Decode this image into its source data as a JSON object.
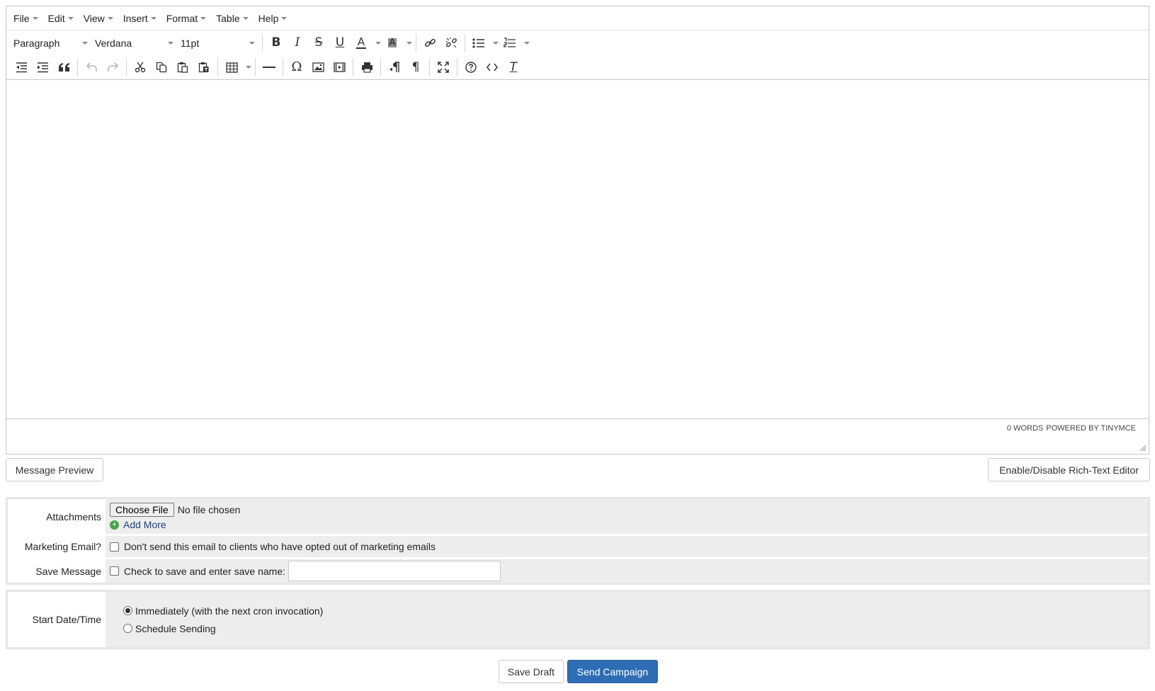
{
  "menubar": {
    "items": [
      "File",
      "Edit",
      "View",
      "Insert",
      "Format",
      "Table",
      "Help"
    ]
  },
  "toolbar": {
    "block_format": "Paragraph",
    "font_family": "Verdana",
    "font_size": "11pt",
    "icons": {
      "bold": "B",
      "italic": "I",
      "strikethrough": "S",
      "underline": "U",
      "text_color": "A",
      "highlight": "A",
      "special_char": "Ω",
      "pilcrow": "¶",
      "clear_format": "T"
    }
  },
  "statusbar": {
    "words": "0 WORDS",
    "powered": "POWERED BY TINYMCE"
  },
  "actions": {
    "message_preview": "Message Preview",
    "toggle_editor": "Enable/Disable Rich-Text Editor"
  },
  "options": {
    "attachments_label": "Attachments",
    "choose_file": "Choose File",
    "no_file": "No file chosen",
    "add_more": "Add More",
    "marketing_label": "Marketing Email?",
    "marketing_text": "Don't send this email to clients who have opted out of marketing emails",
    "save_label": "Save Message",
    "save_text": "Check to save and enter save name:"
  },
  "schedule": {
    "label": "Start Date/Time",
    "immediately": "Immediately (with the next cron invocation)",
    "schedule_sending": "Schedule Sending"
  },
  "footer": {
    "save_draft": "Save Draft",
    "send_campaign": "Send Campaign"
  },
  "colors": {
    "primary": "#2e6db4",
    "field_bg": "#ededed",
    "add_more_link": "#1b3f80"
  }
}
